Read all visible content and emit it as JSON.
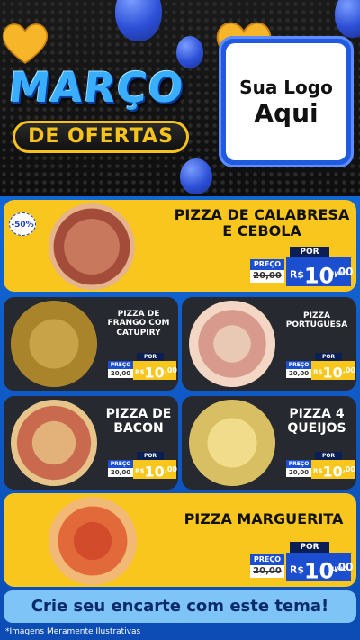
{
  "header": {
    "title_line1": "MARÇO",
    "title_line2": "DE OFERTAS",
    "logo_line1": "Sua Logo",
    "logo_line2": "Aqui"
  },
  "featured1": {
    "discount": "-50%",
    "name_line1": "PIZZA DE CALABRESA",
    "name_line2": "E CEBOLA",
    "por": "POR",
    "preco": "PREÇO",
    "old_prefix": "R$",
    "old_price": "20,00",
    "currency": "R$",
    "new_int": "10",
    "new_cents": ",00",
    "unit": "UNID"
  },
  "grid": [
    {
      "name_line1": "PIZZA DE",
      "name_line2": "FRANGO COM",
      "name_line3": "CATUPIRY",
      "por": "POR",
      "preco": "PREÇO",
      "old_price": "20,00",
      "currency": "R$",
      "new_int": "10",
      "new_cents": ",00",
      "unit": "UNID"
    },
    {
      "name_line1": "PIZZA",
      "name_line2": "PORTUGUESA",
      "por": "POR",
      "preco": "PREÇO",
      "old_price": "20,00",
      "currency": "R$",
      "new_int": "10",
      "new_cents": ",00",
      "unit": "UNID"
    },
    {
      "name_line1": "PIZZA DE",
      "name_line2": "BACON",
      "por": "POR",
      "preco": "PREÇO",
      "old_price": "20,00",
      "currency": "R$",
      "new_int": "10",
      "new_cents": ",00",
      "unit": "UNID"
    },
    {
      "name_line1": "PIZZA 4",
      "name_line2": "QUEIJOS",
      "por": "POR",
      "preco": "PREÇO",
      "old_price": "20,00",
      "currency": "R$",
      "new_int": "10",
      "new_cents": ",00",
      "unit": "UNID"
    }
  ],
  "featured2": {
    "name": "PIZZA MARGUERITA",
    "por": "POR",
    "preco": "PREÇO",
    "old_price": "20,00",
    "currency": "R$",
    "new_int": "10",
    "new_cents": ",00",
    "unit": "UNID"
  },
  "cta": "Crie seu encarte com este tema!",
  "footnote": "*Imagens Meramente Ilustrativas",
  "colors": {
    "brand_yellow": "#f8c61c",
    "brand_blue": "#1c4fd0",
    "dark_card": "#26292f"
  },
  "icons": [
    "balloon-icon",
    "heart-icon"
  ]
}
